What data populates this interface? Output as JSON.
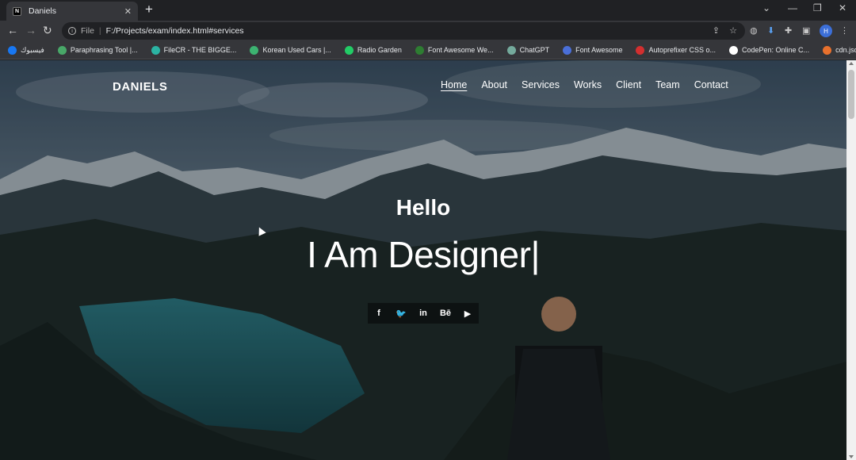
{
  "browser": {
    "tab_title": "Daniels",
    "tab_icon": "N",
    "tab_close": "✕",
    "new_tab": "+",
    "address_scheme": "File",
    "address_separator": "|",
    "address_url": "F:/Projects/exam/index.html#services",
    "profile_initial": "H",
    "bookmarks": [
      {
        "label": "فيسبوك",
        "color": "#1877f2"
      },
      {
        "label": "Paraphrasing Tool |...",
        "color": "#48a868"
      },
      {
        "label": "FileCR - THE BIGGE...",
        "color": "#2bb3a3"
      },
      {
        "label": "Korean Used Cars |...",
        "color": "#3cb371"
      },
      {
        "label": "Radio Garden",
        "color": "#22cc66"
      },
      {
        "label": "Font Awesome We...",
        "color": "#2e7d32"
      },
      {
        "label": "ChatGPT",
        "color": "#74aa9c"
      },
      {
        "label": "Font Awesome",
        "color": "#4a6fd8"
      },
      {
        "label": "Autoprefixer CSS o...",
        "color": "#d32f2f"
      },
      {
        "label": "CodePen: Online C...",
        "color": "#ffffff"
      },
      {
        "label": "cdn.jsdelivr.net/np...",
        "color": "#e8712d"
      }
    ]
  },
  "site": {
    "brand": "DANIELS",
    "menu": [
      "Home",
      "About",
      "Services",
      "Works",
      "Client",
      "Team",
      "Contact"
    ],
    "hello": "Hello",
    "tagline": "I Am Designer",
    "caret": "|",
    "social": [
      {
        "icon": "facebook-icon",
        "glyph": "f"
      },
      {
        "icon": "twitter-icon",
        "glyph": "🐦"
      },
      {
        "icon": "linkedin-icon",
        "glyph": "in"
      },
      {
        "icon": "behance-icon",
        "glyph": "Bē"
      },
      {
        "icon": "youtube-icon",
        "glyph": "▶"
      }
    ]
  }
}
